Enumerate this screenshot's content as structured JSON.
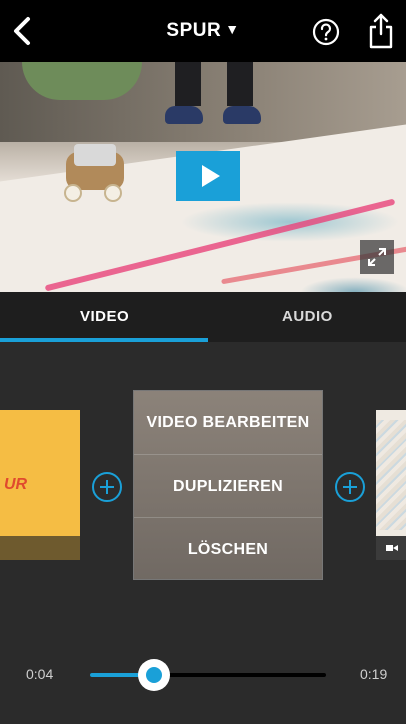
{
  "header": {
    "title": "SPUR",
    "title_dropdown_icon": "chevron-down-icon",
    "back_icon": "chevron-left-icon",
    "help_icon": "help-circle-icon",
    "share_icon": "share-icon"
  },
  "player": {
    "play_icon": "play-icon",
    "expand_icon": "expand-icon"
  },
  "tabs": [
    {
      "label": "VIDEO",
      "active": true
    },
    {
      "label": "AUDIO",
      "active": false
    }
  ],
  "clips": {
    "left_clip_title": "UR",
    "right_clip_icon": "video-camera-icon"
  },
  "context_menu": {
    "items": [
      "VIDEO BEARBEITEN",
      "DUPLIZIEREN",
      "LÖSCHEN"
    ]
  },
  "timeline": {
    "start_time": "0:04",
    "end_time": "0:19",
    "progress": 0.27
  },
  "colors": {
    "accent": "#1aa0d8",
    "background": "#2b2b2b",
    "header": "#000000"
  }
}
